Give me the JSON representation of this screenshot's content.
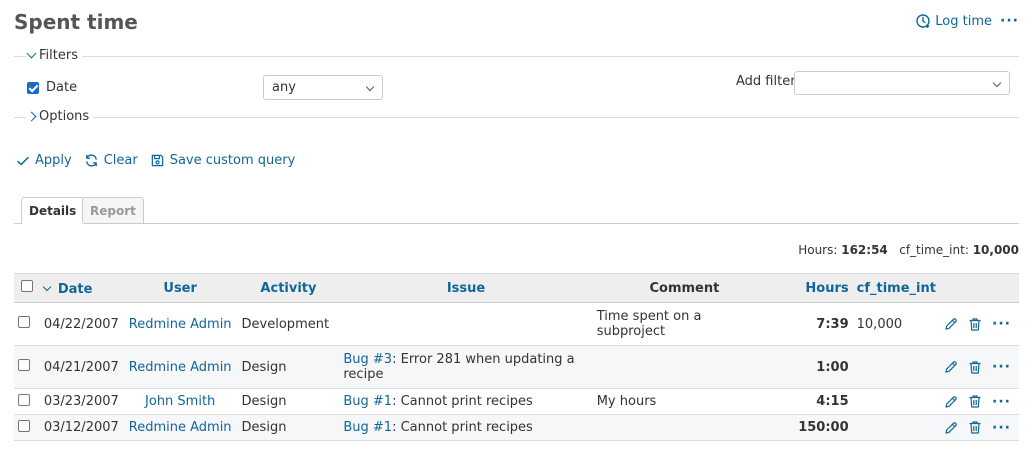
{
  "header": {
    "title": "Spent time",
    "log_time_label": "Log time",
    "more_label": "···"
  },
  "filters": {
    "legend": "Filters",
    "date_label": "Date",
    "date_checked": true,
    "date_operator": "any",
    "add_filter_label": "Add filter",
    "add_filter_value": ""
  },
  "options": {
    "legend": "Options"
  },
  "query_actions": {
    "apply": "Apply",
    "clear": "Clear",
    "save": "Save custom query"
  },
  "tabs": [
    {
      "label": "Details",
      "active": true
    },
    {
      "label": "Report",
      "active": false
    }
  ],
  "totals": {
    "hours_label": "Hours:",
    "hours_value": "162:54",
    "cf_label": "cf_time_int:",
    "cf_value": "10,000"
  },
  "table": {
    "columns": {
      "date": "Date",
      "user": "User",
      "activity": "Activity",
      "issue": "Issue",
      "comment": "Comment",
      "hours": "Hours",
      "cf_time_int": "cf_time_int"
    },
    "rows": [
      {
        "date": "04/22/2007",
        "user": "Redmine Admin",
        "activity": "Development",
        "issue_link": "",
        "issue_text": "",
        "comment": "Time spent on a subproject",
        "hours": "7:39",
        "cf_time_int": "10,000"
      },
      {
        "date": "04/21/2007",
        "user": "Redmine Admin",
        "activity": "Design",
        "issue_link": "Bug #3",
        "issue_text": ": Error 281 when updating a recipe",
        "comment": "",
        "hours": "1:00",
        "cf_time_int": ""
      },
      {
        "date": "03/23/2007",
        "user": "John Smith",
        "activity": "Design",
        "issue_link": "Bug #1",
        "issue_text": ": Cannot print recipes",
        "comment": "My hours",
        "hours": "4:15",
        "cf_time_int": ""
      },
      {
        "date": "03/12/2007",
        "user": "Redmine Admin",
        "activity": "Design",
        "issue_link": "Bug #1",
        "issue_text": ": Cannot print recipes",
        "comment": "",
        "hours": "150:00",
        "cf_time_int": ""
      }
    ],
    "row_more_label": "···"
  }
}
